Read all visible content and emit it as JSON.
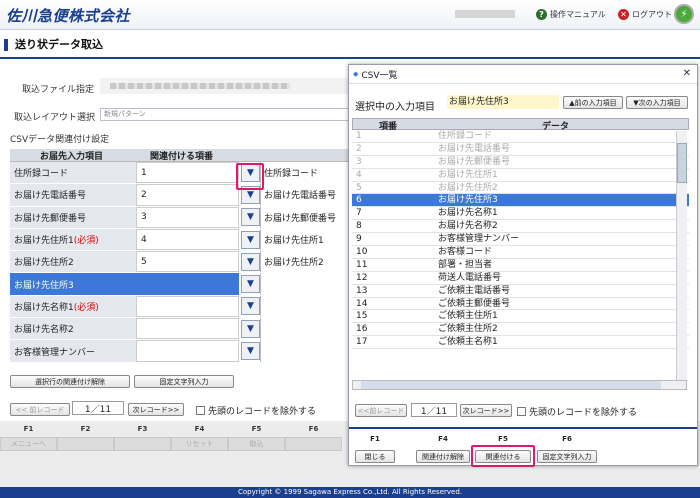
{
  "header": {
    "logo": "佐川急便株式会社",
    "manual": "操作マニュアル",
    "logout": "ログアウト"
  },
  "page": {
    "title": "送り状データ取込"
  },
  "form": {
    "file_label": "取込ファイル指定",
    "layout_label": "取込レイアウト選択",
    "layout_value": "新規パターン",
    "csv_label": "CSVデータ関連付け設定"
  },
  "table": {
    "col1": "お届先入力項目",
    "col2": "関連付ける項番",
    "rows": [
      {
        "label": "住所録コード",
        "req": "",
        "num": "1",
        "data": "住所録コード"
      },
      {
        "label": "お届け先電話番号",
        "req": "",
        "num": "2",
        "data": "お届け先電話番号"
      },
      {
        "label": "お届け先郵便番号",
        "req": "",
        "num": "3",
        "data": "お届け先郵便番号"
      },
      {
        "label": "お届け先住所1",
        "req": "(必須)",
        "num": "4",
        "data": "お届け先住所1"
      },
      {
        "label": "お届け先住所2",
        "req": "",
        "num": "5",
        "data": "お届け先住所2"
      },
      {
        "label": "お届け先住所3",
        "req": "",
        "num": "",
        "data": ""
      },
      {
        "label": "お届け先名称1",
        "req": "(必須)",
        "num": "",
        "data": ""
      },
      {
        "label": "お届け先名称2",
        "req": "",
        "num": "",
        "data": ""
      },
      {
        "label": "お客様管理ナンバー",
        "req": "",
        "num": "",
        "data": ""
      }
    ]
  },
  "buttons": {
    "release": "選択行の関連付け解除",
    "fixed": "固定文字列入力",
    "prev": "<< 前レコード",
    "next": "次レコード>>",
    "exclude": "先頭のレコードを除外する",
    "page": "1／11"
  },
  "fkeys": [
    {
      "key": "F1",
      "label": "メニューへ"
    },
    {
      "key": "F2",
      "label": ""
    },
    {
      "key": "F3",
      "label": ""
    },
    {
      "key": "F4",
      "label": "リセット"
    },
    {
      "key": "F5",
      "label": "取込"
    },
    {
      "key": "F6",
      "label": ""
    }
  ],
  "copyright": "Copyright © 1999 Sagawa Express Co.,Ltd. All Rights Reserved.",
  "dialog": {
    "title": "CSV一覧",
    "selected_label": "選択中の入力項目",
    "selected_value": "お届け先住所3",
    "prev_item": "▲前の入力項目",
    "next_item": "▼次の入力項目",
    "col_no": "項番",
    "col_data": "データ",
    "rows": [
      {
        "n": "1",
        "v": "住所録コード",
        "state": "dis"
      },
      {
        "n": "2",
        "v": "お届け先電話番号",
        "state": "dis"
      },
      {
        "n": "3",
        "v": "お届け先郵便番号",
        "state": "dis"
      },
      {
        "n": "4",
        "v": "お届け先住所1",
        "state": "dis"
      },
      {
        "n": "5",
        "v": "お届け先住所2",
        "state": "dis"
      },
      {
        "n": "6",
        "v": "お届け先住所3",
        "state": "sel"
      },
      {
        "n": "7",
        "v": "お届け先名称1",
        "state": ""
      },
      {
        "n": "8",
        "v": "お届け先名称2",
        "state": ""
      },
      {
        "n": "9",
        "v": "お客様管理ナンバー",
        "state": ""
      },
      {
        "n": "10",
        "v": "お客様コード",
        "state": ""
      },
      {
        "n": "11",
        "v": "部署・担当者",
        "state": ""
      },
      {
        "n": "12",
        "v": "荷送人電話番号",
        "state": ""
      },
      {
        "n": "13",
        "v": "ご依頼主電話番号",
        "state": ""
      },
      {
        "n": "14",
        "v": "ご依頼主郵便番号",
        "state": ""
      },
      {
        "n": "15",
        "v": "ご依頼主住所1",
        "state": ""
      },
      {
        "n": "16",
        "v": "ご依頼主住所2",
        "state": ""
      },
      {
        "n": "17",
        "v": "ご依頼主名称1",
        "state": ""
      }
    ],
    "prev": "<<前レコード",
    "next": "次レコード>>",
    "page": "1／11",
    "exclude": "先頭のレコードを除外する",
    "fkeys": [
      {
        "key": "F1",
        "label": "閉じる"
      },
      {
        "key": "F4",
        "label": "関連付け解除"
      },
      {
        "key": "F5",
        "label": "関連付ける"
      },
      {
        "key": "F6",
        "label": "固定文字列入力"
      }
    ]
  }
}
